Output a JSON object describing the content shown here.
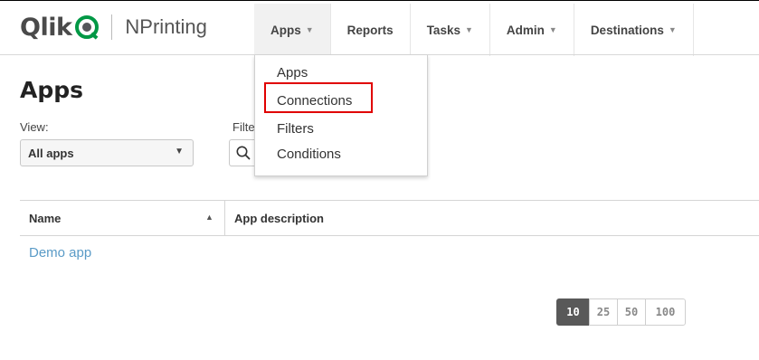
{
  "brand": {
    "logo_text": "Qlik",
    "product": "NPrinting"
  },
  "nav": {
    "items": [
      {
        "label": "Apps",
        "has_caret": true,
        "active": true
      },
      {
        "label": "Reports",
        "has_caret": false,
        "active": false
      },
      {
        "label": "Tasks",
        "has_caret": true,
        "active": false
      },
      {
        "label": "Admin",
        "has_caret": true,
        "active": false
      },
      {
        "label": "Destinations",
        "has_caret": true,
        "active": false
      }
    ],
    "caret_glyph": "▼"
  },
  "apps_menu": {
    "items": [
      "Apps",
      "Connections",
      "Filters",
      "Conditions"
    ],
    "highlighted": "Connections",
    "highlight_color": "#e00000"
  },
  "page": {
    "title": "Apps",
    "view_label": "View:",
    "filter_label": "Filte",
    "view_select_value": "All apps"
  },
  "table": {
    "col_name": "Name",
    "col_description": "App description",
    "sort_glyph": "▲",
    "rows": [
      {
        "name": "Demo app",
        "description": ""
      }
    ]
  },
  "pagination": {
    "sizes": [
      "10",
      "25",
      "50",
      "100"
    ],
    "active": "10"
  },
  "colors": {
    "brand_green": "#009845",
    "link_blue": "#5a9bc7",
    "active_page_bg": "#595959"
  }
}
